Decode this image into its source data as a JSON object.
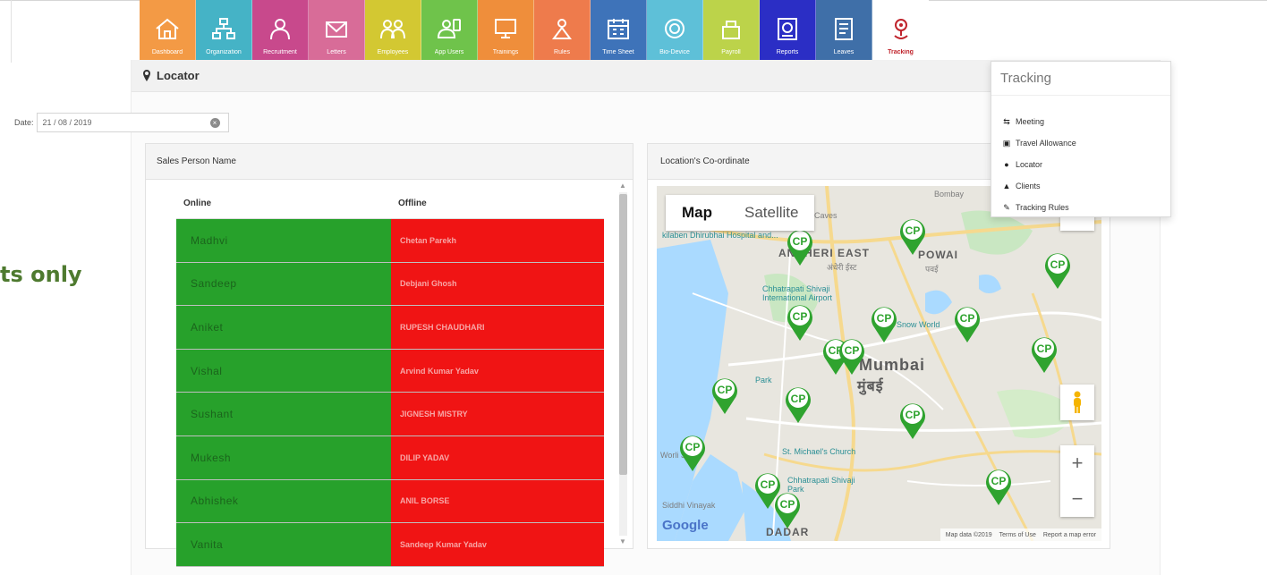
{
  "caption": "ts only",
  "modules": [
    {
      "label": "Dashboard",
      "icon": "home-icon",
      "color": "#f39a45"
    },
    {
      "label": "Organization",
      "icon": "organization-chart-icon",
      "color": "#45b3c6"
    },
    {
      "label": "Recruitment",
      "icon": "recruitment-icon",
      "color": "#c8498c"
    },
    {
      "label": "Letters",
      "icon": "letters-icon",
      "color": "#d86c98"
    },
    {
      "label": "Employees",
      "icon": "employees-icon",
      "color": "#d3c832"
    },
    {
      "label": "App Users",
      "icon": "app-users-icon",
      "color": "#6fc34b"
    },
    {
      "label": "Trainings",
      "icon": "trainings-icon",
      "color": "#ef8e3b"
    },
    {
      "label": "Rules",
      "icon": "rules-icon",
      "color": "#ee7b4c"
    },
    {
      "label": "Time Sheet",
      "icon": "time-sheet-icon",
      "color": "#3e73b9"
    },
    {
      "label": "Bio-Device",
      "icon": "bio-device-icon",
      "color": "#5ec0d8"
    },
    {
      "label": "Payroll",
      "icon": "payroll-icon",
      "color": "#bcd34a"
    },
    {
      "label": "Reports",
      "icon": "reports-icon",
      "color": "#2b2ec5"
    },
    {
      "label": "Leaves",
      "icon": "leaves-icon",
      "color": "#3f6fa8"
    },
    {
      "label": "Tracking",
      "icon": "tracking-icon",
      "color": "#ffffff"
    }
  ],
  "locator": {
    "title": "Locator"
  },
  "date": {
    "label": "Date:",
    "value": "21 / 08 / 2019"
  },
  "sales_panel": {
    "title": "Sales Person Name",
    "col_online": "Online",
    "col_offline": "Offline",
    "rows": [
      {
        "online": "Madhvi",
        "offline": "Chetan Parekh"
      },
      {
        "online": "Sandeep",
        "offline": "Debjani Ghosh"
      },
      {
        "online": "Aniket",
        "offline": "RUPESH CHAUDHARI"
      },
      {
        "online": "Vishal",
        "offline": "Arvind Kumar Yadav"
      },
      {
        "online": "Sushant",
        "offline": "JIGNESH MISTRY"
      },
      {
        "online": "Mukesh",
        "offline": "DILIP YADAV"
      },
      {
        "online": "Abhishek",
        "offline": "ANIL BORSE"
      },
      {
        "online": "Vanita",
        "offline": "Sandeep Kumar Yadav"
      }
    ]
  },
  "location_panel": {
    "title": "Location's Co-ordinate"
  },
  "map": {
    "type_map": "Map",
    "type_satellite": "Satellite",
    "marker_label": "CP",
    "google": "Google",
    "footer": {
      "data": "Map data ©2019",
      "terms": "Terms of Use",
      "report": "Report a map error"
    },
    "labels": {
      "andheri": "ANDHERI EAST",
      "andheri_hi": "अंधेरी ईस्ट",
      "powai": "POWAI",
      "powai_hi": "पवई",
      "mumbai": "Mumbai",
      "mumbai_hi": "मुंबई",
      "dadar": "DADAR",
      "bombay": "Bombay",
      "caves": "Caves",
      "hospital": "kilaben Dhirubhai Hospital and...",
      "airport": "Chhatrapati Shivaji International Airport",
      "world": "Snow World",
      "park": "Park",
      "michael": "St. Michael's Church",
      "shivaji_park": "Chhatrapati Shivaji Park",
      "siddhi": "Siddhi Vinayak",
      "worli": "Worli Sea"
    }
  },
  "tracking_menu": {
    "title": "Tracking",
    "items": [
      {
        "label": "Meeting",
        "icon": "handshake-icon"
      },
      {
        "label": "Travel Allowance",
        "icon": "car-icon"
      },
      {
        "label": "Locator",
        "icon": "map-pin-icon"
      },
      {
        "label": "Clients",
        "icon": "user-icon"
      },
      {
        "label": "Tracking Rules",
        "icon": "wrench-icon"
      }
    ]
  },
  "colors": {
    "online": "#27a12b",
    "offline": "#f01414",
    "marker": "#2fa32f",
    "caption": "#4e7a2f"
  }
}
